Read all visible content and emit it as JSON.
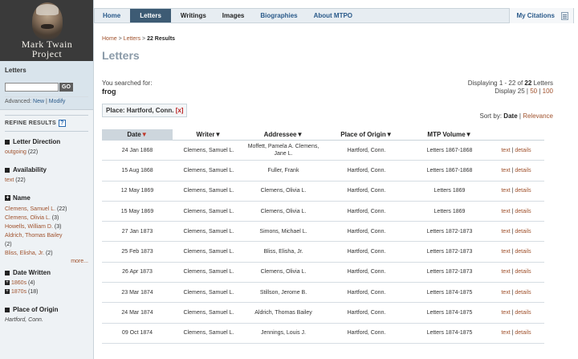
{
  "logo": {
    "line1": "Mark Twain",
    "line2": "Project"
  },
  "sidebar": {
    "search_label": "Letters",
    "go_label": "GO",
    "advanced_label": "Advanced:",
    "new_label": "New",
    "sep": "|",
    "modify_label": "Modify",
    "refine_label": "REFINE RESULTS",
    "help_label": "?",
    "facets": {
      "direction": {
        "title": "Letter Direction",
        "value": "outgoing",
        "count": "(22)"
      },
      "availability": {
        "title": "Availability",
        "value": "text",
        "count": "(22)"
      },
      "name": {
        "title": "Name",
        "items": [
          {
            "label": "Clemens, Samuel L.",
            "count": "(22)"
          },
          {
            "label": "Clemens, Olivia L.",
            "count": "(3)"
          },
          {
            "label": "Howells, William D.",
            "count": "(3)"
          },
          {
            "label": "Aldrich, Thomas Bailey",
            "count": "(2)"
          },
          {
            "label": "Bliss, Elisha, Jr.",
            "count": "(2)"
          }
        ],
        "more": "more..."
      },
      "date": {
        "title": "Date Written",
        "items": [
          {
            "label": "1860s",
            "count": "(4)"
          },
          {
            "label": "1870s",
            "count": "(18)"
          }
        ]
      },
      "origin": {
        "title": "Place of Origin",
        "value": "Hartford, Conn."
      }
    }
  },
  "nav": {
    "tabs": [
      {
        "label": "Home"
      },
      {
        "label": "Letters"
      },
      {
        "label": "Writings"
      },
      {
        "label": "Images"
      },
      {
        "label": "Biographies"
      },
      {
        "label": "About MTPO"
      }
    ],
    "citations": "My Citations"
  },
  "main": {
    "crumb_home": "Home",
    "crumb_sep": " > ",
    "crumb_letters": "Letters",
    "crumb_results": "22 Results",
    "title": "Letters",
    "searched_label": "You searched for:",
    "searched_term": "frog",
    "displaying_prefix": "Displaying 1 - 22 of ",
    "displaying_total": "22",
    "displaying_suffix": " Letters",
    "display_label": "Display 25 |",
    "display_50": "50",
    "display_sep": "|",
    "display_100": "100",
    "place_chip": "Place: Hartford, Conn.",
    "place_remove": "[x]",
    "sort_label": "Sort by:",
    "sort_date": "Date",
    "sort_sep": "|",
    "sort_relevance": "Relevance"
  },
  "table": {
    "headers": {
      "date": "Date",
      "writer": "Writer",
      "addressee": "Addressee",
      "origin": "Place of Origin",
      "volume": "MTP Volume"
    },
    "arrow": "▼",
    "text_link": "text",
    "details_link": "details",
    "rows": [
      {
        "date": "24 Jan 1868",
        "writer": "Clemens, Samuel L.",
        "addressee": "Moffett, Pamela A. Clemens, Jane L.",
        "place": "Hartford, Conn.",
        "volume": "Letters 1867-1868"
      },
      {
        "date": "15 Aug 1868",
        "writer": "Clemens, Samuel L.",
        "addressee": "Fuller, Frank",
        "place": "Hartford, Conn.",
        "volume": "Letters 1867-1868"
      },
      {
        "date": "12 May 1869",
        "writer": "Clemens, Samuel L.",
        "addressee": "Clemens, Olivia L.",
        "place": "Hartford, Conn.",
        "volume": "Letters 1869"
      },
      {
        "date": "15 May 1869",
        "writer": "Clemens, Samuel L.",
        "addressee": "Clemens, Olivia L.",
        "place": "Hartford, Conn.",
        "volume": "Letters 1869"
      },
      {
        "date": "27 Jan 1873",
        "writer": "Clemens, Samuel L.",
        "addressee": "Simons, Michael L.",
        "place": "Hartford, Conn.",
        "volume": "Letters 1872-1873"
      },
      {
        "date": "25 Feb 1873",
        "writer": "Clemens, Samuel L.",
        "addressee": "Bliss, Elisha, Jr.",
        "place": "Hartford, Conn.",
        "volume": "Letters 1872-1873"
      },
      {
        "date": "26 Apr 1873",
        "writer": "Clemens, Samuel L.",
        "addressee": "Clemens, Olivia L.",
        "place": "Hartford, Conn.",
        "volume": "Letters 1872-1873"
      },
      {
        "date": "23 Mar 1874",
        "writer": "Clemens, Samuel L.",
        "addressee": "Stillson, Jerome B.",
        "place": "Hartford, Conn.",
        "volume": "Letters 1874-1875"
      },
      {
        "date": "24 Mar 1874",
        "writer": "Clemens, Samuel L.",
        "addressee": "Aldrich, Thomas Bailey",
        "place": "Hartford, Conn.",
        "volume": "Letters 1874-1875"
      },
      {
        "date": "09 Oct 1874",
        "writer": "Clemens, Samuel L.",
        "addressee": "Jennings, Louis J.",
        "place": "Hartford, Conn.",
        "volume": "Letters 1874-1875"
      }
    ]
  }
}
